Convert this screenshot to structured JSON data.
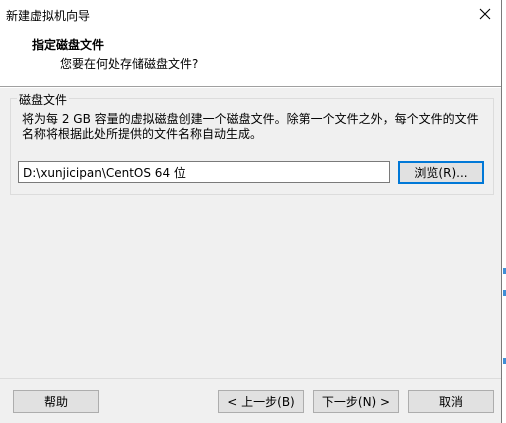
{
  "window": {
    "title": "新建虚拟机向导"
  },
  "header": {
    "title": "指定磁盘文件",
    "subtitle": "您要在何处存储磁盘文件?"
  },
  "disk_file": {
    "group_label": "磁盘文件",
    "description": "将为每 2 GB 容量的虚拟磁盘创建一个磁盘文件。除第一个文件之外，每个文件的文件名称将根据此处所提供的文件名称自动生成。",
    "path_value": "D:\\xunjicipan\\CentOS 64 位",
    "browse_label": "浏览(R)..."
  },
  "footer": {
    "help_label": "帮助",
    "back_label": "< 上一步(B)",
    "next_label": "下一步(N) >",
    "cancel_label": "取消"
  },
  "icons": {
    "close": "close-icon"
  },
  "colors": {
    "dialog_bg": "#f0f0f0",
    "header_bg": "#ffffff",
    "button_bg": "#e1e1e1",
    "focus_border": "#0078d7"
  }
}
